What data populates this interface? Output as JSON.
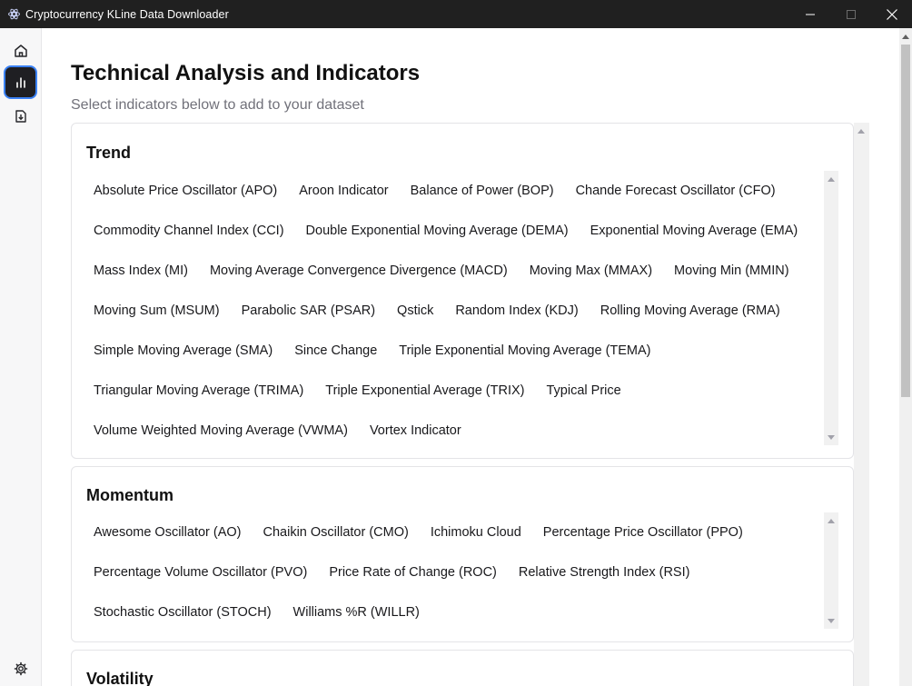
{
  "window": {
    "title": "Cryptocurrency KLine Data Downloader"
  },
  "sidebar": {
    "items": [
      {
        "icon": "home-icon"
      },
      {
        "icon": "bar-chart-icon",
        "active": true
      },
      {
        "icon": "download-icon"
      }
    ],
    "footer_icon": "gear-icon"
  },
  "main": {
    "title": "Technical Analysis and Indicators",
    "subtitle": "Select indicators below to add to your dataset"
  },
  "sections": {
    "trend": {
      "title": "Trend",
      "rows": [
        [
          "Absolute Price Oscillator (APO)",
          "Aroon Indicator",
          "Balance of Power (BOP)",
          "Chande Forecast Oscillator (CFO)"
        ],
        [
          "Commodity Channel Index (CCI)",
          "Double Exponential Moving Average (DEMA)",
          "Exponential Moving Average (EMA)"
        ],
        [
          "Mass Index (MI)",
          "Moving Average Convergence Divergence (MACD)",
          "Moving Max (MMAX)",
          "Moving Min (MMIN)"
        ],
        [
          "Moving Sum (MSUM)",
          "Parabolic SAR (PSAR)",
          "Qstick",
          "Random Index (KDJ)",
          "Rolling Moving Average (RMA)"
        ],
        [
          "Simple Moving Average (SMA)",
          "Since Change",
          "Triple Exponential Moving Average (TEMA)"
        ],
        [
          "Triangular Moving Average (TRIMA)",
          "Triple Exponential Average (TRIX)",
          "Typical Price"
        ],
        [
          "Volume Weighted Moving Average (VWMA)",
          "Vortex Indicator"
        ]
      ]
    },
    "momentum": {
      "title": "Momentum",
      "rows": [
        [
          "Awesome Oscillator (AO)",
          "Chaikin Oscillator (CMO)",
          "Ichimoku Cloud",
          "Percentage Price Oscillator (PPO)"
        ],
        [
          "Percentage Volume Oscillator (PVO)",
          "Price Rate of Change (ROC)",
          "Relative Strength Index (RSI)"
        ],
        [
          "Stochastic Oscillator (STOCH)",
          "Williams %R (WILLR)"
        ]
      ]
    },
    "volatility": {
      "title": "Volatility"
    }
  },
  "colors": {
    "titlebar": "#202020",
    "sidebar": "#f7f7f8",
    "active_nav": "#1f1f23",
    "focus_ring": "#3b82f6",
    "text": "#18181b",
    "muted": "#71717a"
  }
}
